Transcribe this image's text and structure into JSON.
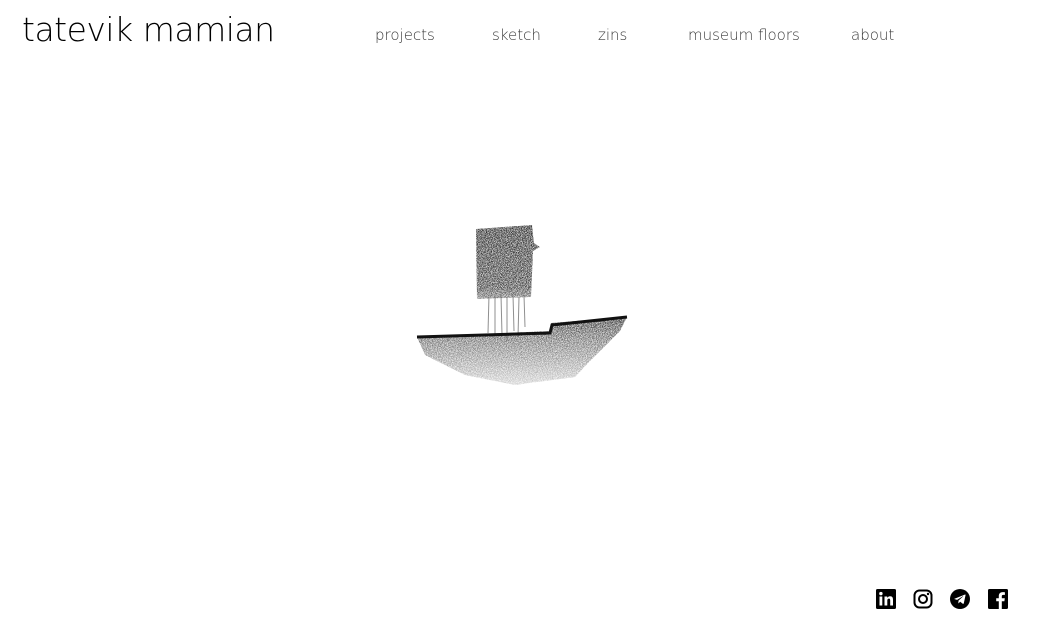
{
  "header": {
    "site_title": "tatevik mamian"
  },
  "nav": {
    "items": [
      {
        "label": "projects"
      },
      {
        "label": "sketch"
      },
      {
        "label": "zins"
      },
      {
        "label": "museum floors"
      },
      {
        "label": "about"
      }
    ]
  },
  "main": {
    "artwork": {
      "icon": "pencil-sketch-image"
    }
  },
  "footer": {
    "social": [
      {
        "icon": "linkedin-icon"
      },
      {
        "icon": "instagram-icon"
      },
      {
        "icon": "telegram-icon"
      },
      {
        "icon": "facebook-icon"
      }
    ]
  },
  "colors": {
    "background": "#ffffff",
    "text": "#000000",
    "nav_text": "#3a3a3a"
  }
}
